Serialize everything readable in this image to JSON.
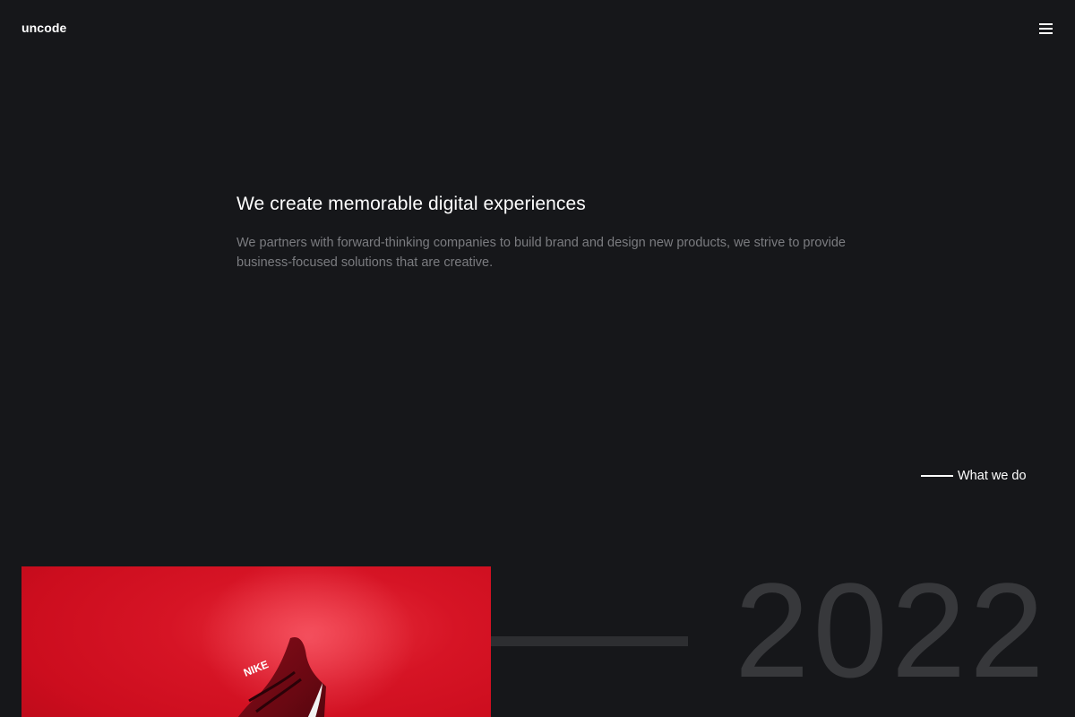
{
  "header": {
    "logo": "uncode",
    "menu_icon": "hamburger-menu-icon"
  },
  "hero": {
    "title": "We create memorable digital experiences",
    "text": "We partners with forward-thinking companies to build brand and design new products, we strive to provide business-focused solutions that are creative."
  },
  "section_link": {
    "label": "What we do"
  },
  "feature": {
    "image_description_icon": "sneaker-image",
    "shoe_brand_text": "NIKE",
    "year": "2022"
  },
  "colors": {
    "background": "#16171a",
    "accent_red": "#d61425",
    "muted_text": "#7b7c80",
    "year_text": "#37383b"
  }
}
